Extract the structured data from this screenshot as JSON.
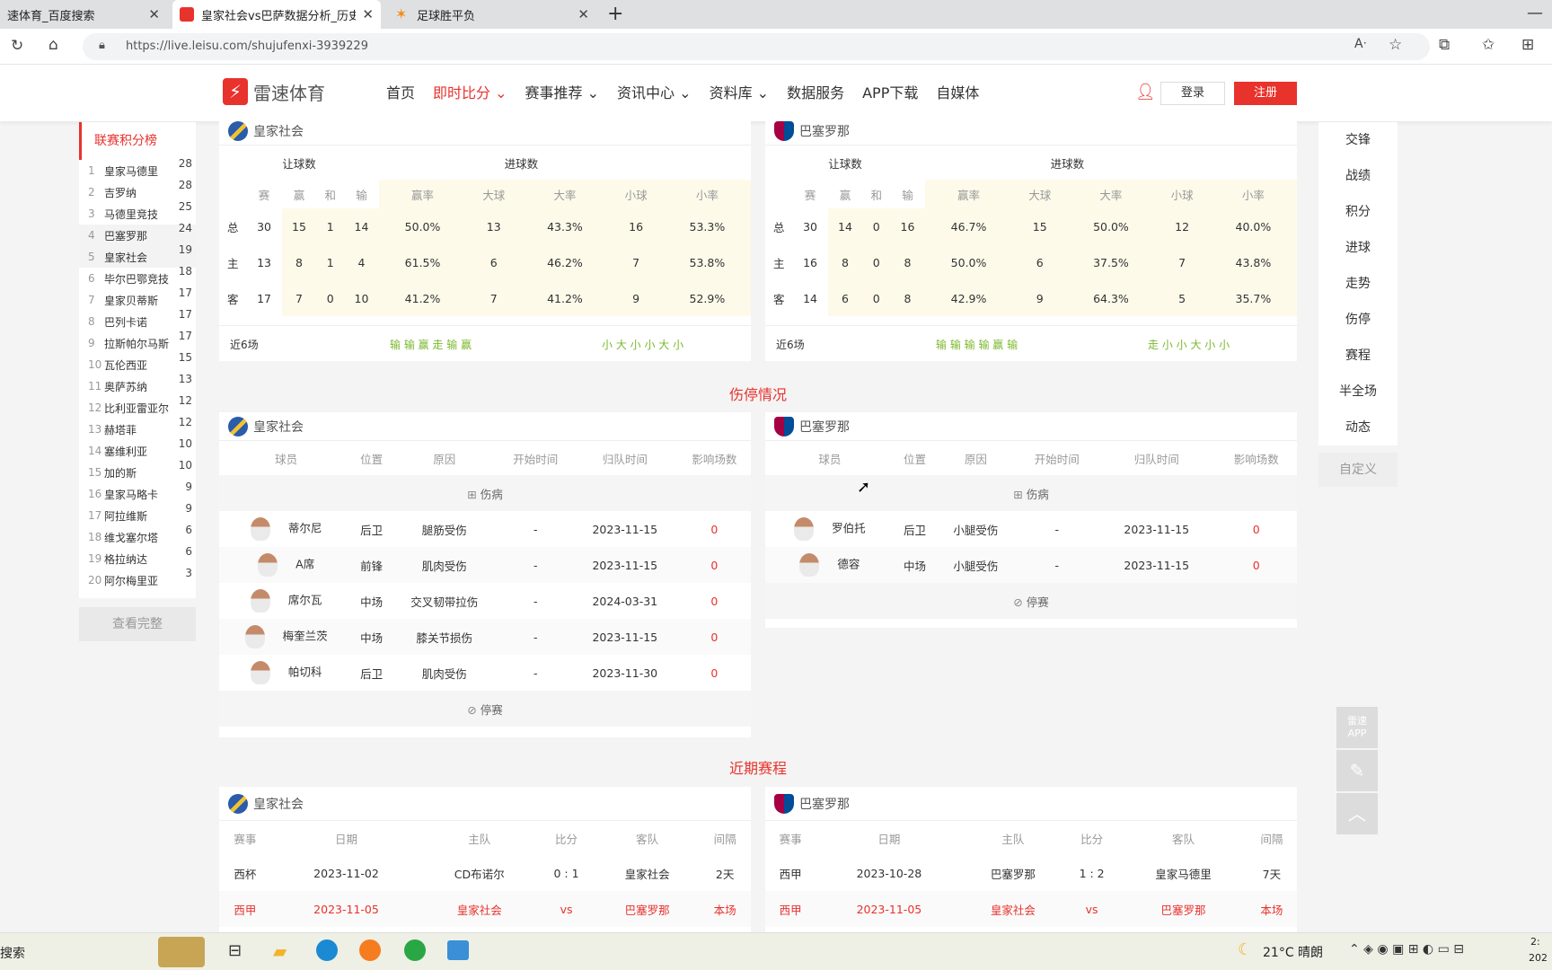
{
  "browser": {
    "tabs": [
      {
        "title": "速体育_百度搜索"
      },
      {
        "title": "皇家社会vs巴萨数据分析_历史战",
        "active": true
      },
      {
        "title": "足球胜平负"
      }
    ],
    "url": "https://live.leisu.com/shujufenxi-3939229"
  },
  "site": {
    "brand": "雷速体育",
    "nav": [
      {
        "label": "首页"
      },
      {
        "label": "即时比分",
        "active": true
      },
      {
        "label": "赛事推荐"
      },
      {
        "label": "资讯中心"
      },
      {
        "label": "资料库"
      },
      {
        "label": "数据服务"
      },
      {
        "label": "APP下载"
      },
      {
        "label": "自媒体"
      }
    ],
    "login": "登录",
    "register": "注册"
  },
  "standings": {
    "title": "联赛积分榜",
    "rows": [
      {
        "rank": "1",
        "team": "皇家马德里",
        "pts": "28"
      },
      {
        "rank": "2",
        "team": "吉罗纳",
        "pts": "28"
      },
      {
        "rank": "3",
        "team": "马德里竞技",
        "pts": "25"
      },
      {
        "rank": "4",
        "team": "巴塞罗那",
        "pts": "24"
      },
      {
        "rank": "5",
        "team": "皇家社会",
        "pts": "19"
      },
      {
        "rank": "6",
        "team": "毕尔巴鄂竞技",
        "pts": "18"
      },
      {
        "rank": "7",
        "team": "皇家贝蒂斯",
        "pts": "17"
      },
      {
        "rank": "8",
        "team": "巴列卡诺",
        "pts": "17"
      },
      {
        "rank": "9",
        "team": "拉斯帕尔马斯",
        "pts": "17"
      },
      {
        "rank": "10",
        "team": "瓦伦西亚",
        "pts": "15"
      },
      {
        "rank": "11",
        "team": "奥萨苏纳",
        "pts": "13"
      },
      {
        "rank": "12",
        "team": "比利亚雷亚尔",
        "pts": "12"
      },
      {
        "rank": "13",
        "team": "赫塔菲",
        "pts": "12"
      },
      {
        "rank": "14",
        "team": "塞维利亚",
        "pts": "10"
      },
      {
        "rank": "15",
        "team": "加的斯",
        "pts": "10"
      },
      {
        "rank": "16",
        "team": "皇家马略卡",
        "pts": "9"
      },
      {
        "rank": "17",
        "team": "阿拉维斯",
        "pts": "9"
      },
      {
        "rank": "18",
        "team": "维戈塞尔塔",
        "pts": "6"
      },
      {
        "rank": "19",
        "team": "格拉纳达",
        "pts": "6"
      },
      {
        "rank": "20",
        "team": "阿尔梅里亚",
        "pts": "3"
      }
    ],
    "see_all": "查看完整"
  },
  "handicap": {
    "group_headers": [
      "让球数",
      "进球数"
    ],
    "columns": [
      "赛",
      "赢",
      "和",
      "输",
      "赢率",
      "大球",
      "大率",
      "小球",
      "小率"
    ],
    "recent_label": "近6场",
    "left": {
      "team": "皇家社会",
      "rows": [
        {
          "label": "总",
          "cells": [
            "30",
            "15",
            "1",
            "14",
            "50.0%",
            "13",
            "43.3%",
            "16",
            "53.3%"
          ]
        },
        {
          "label": "主",
          "cells": [
            "13",
            "8",
            "1",
            "4",
            "61.5%",
            "6",
            "46.2%",
            "7",
            "53.8%"
          ]
        },
        {
          "label": "客",
          "cells": [
            "17",
            "7",
            "0",
            "10",
            "41.2%",
            "7",
            "41.2%",
            "9",
            "52.9%"
          ]
        }
      ],
      "recent_a": "输 输 赢 走 输 赢",
      "recent_b": "小 大 小 小 大 小"
    },
    "right": {
      "team": "巴塞罗那",
      "rows": [
        {
          "label": "总",
          "cells": [
            "30",
            "14",
            "0",
            "16",
            "46.7%",
            "15",
            "50.0%",
            "12",
            "40.0%"
          ]
        },
        {
          "label": "主",
          "cells": [
            "16",
            "8",
            "0",
            "8",
            "50.0%",
            "6",
            "37.5%",
            "7",
            "43.8%"
          ]
        },
        {
          "label": "客",
          "cells": [
            "14",
            "6",
            "0",
            "8",
            "42.9%",
            "9",
            "64.3%",
            "5",
            "35.7%"
          ]
        }
      ],
      "recent_a": "输 输 输 输 赢 输",
      "recent_b": "走 小 小 大 小 小"
    }
  },
  "injury": {
    "title": "伤停情况",
    "columns": [
      "球员",
      "位置",
      "原因",
      "开始时间",
      "归队时间",
      "影响场数"
    ],
    "injured_label": "伤病",
    "suspended_label": "停赛",
    "left": {
      "team": "皇家社会",
      "rows": [
        {
          "name": "蒂尔尼",
          "pos": "后卫",
          "reason": "腿筋受伤",
          "start": "-",
          "back": "2023-11-15",
          "games": "0"
        },
        {
          "name": "A席",
          "pos": "前锋",
          "reason": "肌肉受伤",
          "start": "-",
          "back": "2023-11-15",
          "games": "0"
        },
        {
          "name": "席尔瓦",
          "pos": "中场",
          "reason": "交叉韧带拉伤",
          "start": "-",
          "back": "2024-03-31",
          "games": "0"
        },
        {
          "name": "梅奎兰茨",
          "pos": "中场",
          "reason": "膝关节损伤",
          "start": "-",
          "back": "2023-11-15",
          "games": "0"
        },
        {
          "name": "帕切科",
          "pos": "后卫",
          "reason": "肌肉受伤",
          "start": "-",
          "back": "2023-11-30",
          "games": "0"
        }
      ]
    },
    "right": {
      "team": "巴塞罗那",
      "rows": [
        {
          "name": "罗伯托",
          "pos": "后卫",
          "reason": "小腿受伤",
          "start": "-",
          "back": "2023-11-15",
          "games": "0"
        },
        {
          "name": "德容",
          "pos": "中场",
          "reason": "小腿受伤",
          "start": "-",
          "back": "2023-11-15",
          "games": "0"
        }
      ]
    }
  },
  "schedule": {
    "title": "近期赛程",
    "columns": [
      "赛事",
      "日期",
      "主队",
      "比分",
      "客队",
      "间隔"
    ],
    "left": {
      "team": "皇家社会",
      "rows": [
        {
          "comp": "西杯",
          "date": "2023-11-02",
          "home": "CD布诺尔",
          "score": "0 : 1",
          "away": "皇家社会",
          "gap": "2天"
        },
        {
          "comp": "西甲",
          "date": "2023-11-05",
          "home": "皇家社会",
          "score": "vs",
          "away": "巴塞罗那",
          "gap": "本场",
          "current": true
        }
      ]
    },
    "right": {
      "team": "巴塞罗那",
      "rows": [
        {
          "comp": "西甲",
          "date": "2023-10-28",
          "home": "巴塞罗那",
          "score": "1 : 2",
          "away": "皇家马德里",
          "gap": "7天"
        },
        {
          "comp": "西甲",
          "date": "2023-11-05",
          "home": "皇家社会",
          "score": "vs",
          "away": "巴塞罗那",
          "gap": "本场",
          "current": true
        }
      ]
    }
  },
  "right_nav": [
    "交锋",
    "战绩",
    "积分",
    "进球",
    "走势",
    "伤停",
    "赛程",
    "半全场",
    "动态"
  ],
  "custom_label": "自定义",
  "float_app": "雷速 APP",
  "taskbar": {
    "search": "搜索",
    "weather": "21°C 晴朗",
    "clock": "2:",
    "date": "202"
  }
}
